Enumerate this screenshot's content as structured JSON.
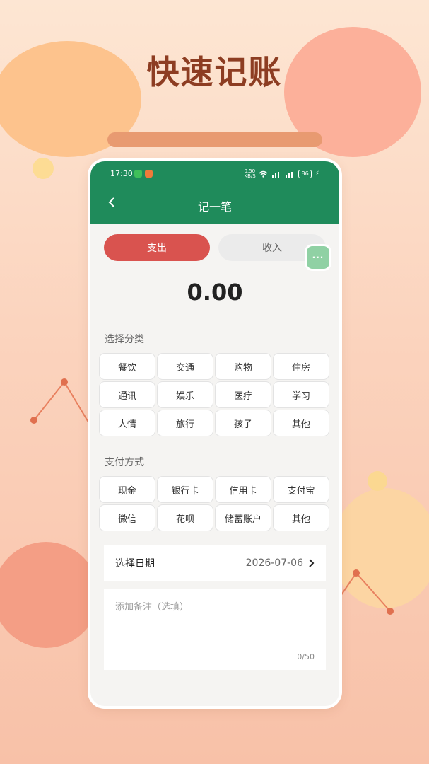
{
  "promo": {
    "title": "快速记账"
  },
  "status_bar": {
    "time": "17:30",
    "network": "0.50 KB/S",
    "battery": "86"
  },
  "nav": {
    "title": "记一笔"
  },
  "type_toggle": {
    "expense_label": "支出",
    "income_label": "收入",
    "selected": "支出"
  },
  "float_menu": {
    "label": "···"
  },
  "amount": {
    "value": "0.00"
  },
  "category": {
    "label": "选择分类",
    "items": [
      "餐饮",
      "交通",
      "购物",
      "住房",
      "通讯",
      "娱乐",
      "医疗",
      "学习",
      "人情",
      "旅行",
      "孩子",
      "其他"
    ]
  },
  "payment": {
    "label": "支付方式",
    "items": [
      "现金",
      "银行卡",
      "信用卡",
      "支付宝",
      "微信",
      "花呗",
      "储蓄账户",
      "其他"
    ]
  },
  "date": {
    "label": "选择日期",
    "value": "2026-07-06"
  },
  "note": {
    "placeholder": "添加备注（选填）",
    "counter": "0/50"
  },
  "colors": {
    "header": "#1f8b5b",
    "expense": "#d9534f",
    "title": "#8d3d22"
  }
}
